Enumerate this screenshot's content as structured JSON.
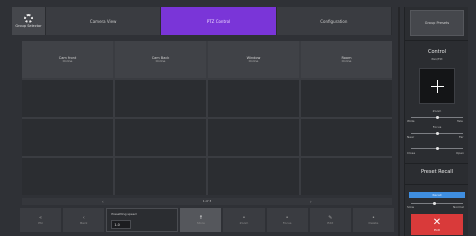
{
  "header": {
    "group_button_label": "Group Selector",
    "tabs": [
      "Camera View",
      "PTZ Control",
      "Configuration"
    ],
    "active_tab_index": 1
  },
  "grid": {
    "cameras": [
      {
        "name": "Cam front",
        "status": "Online"
      },
      {
        "name": "Cam Back",
        "status": "Online"
      },
      {
        "name": "Window",
        "status": "Online"
      },
      {
        "name": "Room",
        "status": "Online"
      }
    ],
    "page_label": "1 of 3"
  },
  "bottom": {
    "buttons": [
      {
        "icon": "«",
        "label": "Ptz"
      },
      {
        "icon": "‹",
        "label": "Back"
      },
      {
        "icon": "↑",
        "label": "Store"
      },
      {
        "icon": "•",
        "label": "Zoom"
      },
      {
        "icon": "•",
        "label": "Focus"
      },
      {
        "icon": "✎",
        "label": "Edit"
      },
      {
        "icon": "•",
        "label": "Delete"
      }
    ],
    "speed_label": "Presetting speed",
    "speed_value": "1.0"
  },
  "sidebar": {
    "top_button": "Group Presets",
    "control_title": "Control",
    "pan_tilt_label": "Pan/Tilt",
    "zoom_label": "Zoom",
    "zoom_left": "Wide",
    "zoom_right": "Tele",
    "focus_label": "Focus",
    "focus_left": "Near",
    "focus_right": "Far",
    "iris_left": "Close",
    "iris_right": "Open",
    "preset_recall": "Preset Recall",
    "recall_button": "Recall",
    "slider_left": "Slow",
    "slider_right": "Normal",
    "close_label": "Exit"
  },
  "colors": {
    "accent": "#7a35d8",
    "recall": "#3f8ee0",
    "close": "#d93a3a"
  }
}
